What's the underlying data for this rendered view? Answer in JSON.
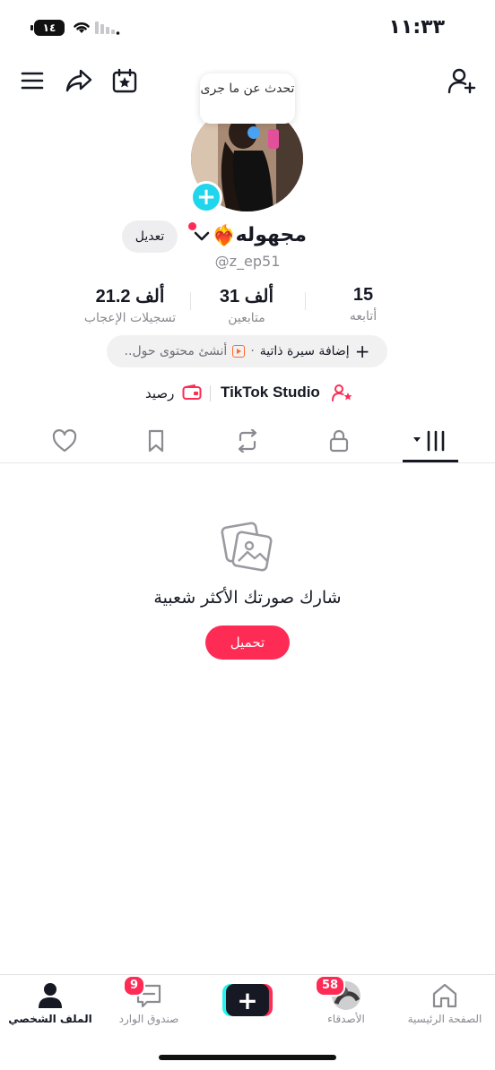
{
  "status_bar": {
    "time": "١١:٣٣",
    "battery": "١٤"
  },
  "profile": {
    "tooltip": "تحدث عن ما جرى",
    "name": "مجهوله",
    "name_emoji": "❤️‍🔥",
    "handle": "@z_ep51",
    "edit_label": "تعديل"
  },
  "stats": [
    {
      "value": "15",
      "label": "أتابعه"
    },
    {
      "value": "31 ألف",
      "label": "متابعين"
    },
    {
      "value": "21.2 ألف",
      "label": "تسجيلات الإعجاب"
    }
  ],
  "bio": {
    "add_label": "إضافة سيرة ذاتية",
    "separator": "·",
    "create_label": "أنشئ محتوى حول.."
  },
  "links": {
    "studio": "TikTok Studio",
    "balance": "رصيد"
  },
  "empty_state": {
    "message": "شارك صورتك الأكثر شعبية",
    "upload_label": "تحميل"
  },
  "bottom_nav": {
    "home": "الصفحة الرئيسية",
    "friends": "الأصدقاء",
    "friends_badge": "58",
    "inbox": "صندوق الوارد",
    "inbox_badge": "9",
    "profile": "الملف الشخصي"
  },
  "colors": {
    "accent": "#fe2c55",
    "cyan": "#20d5ec",
    "text": "#161823",
    "muted": "#8a8b91"
  }
}
